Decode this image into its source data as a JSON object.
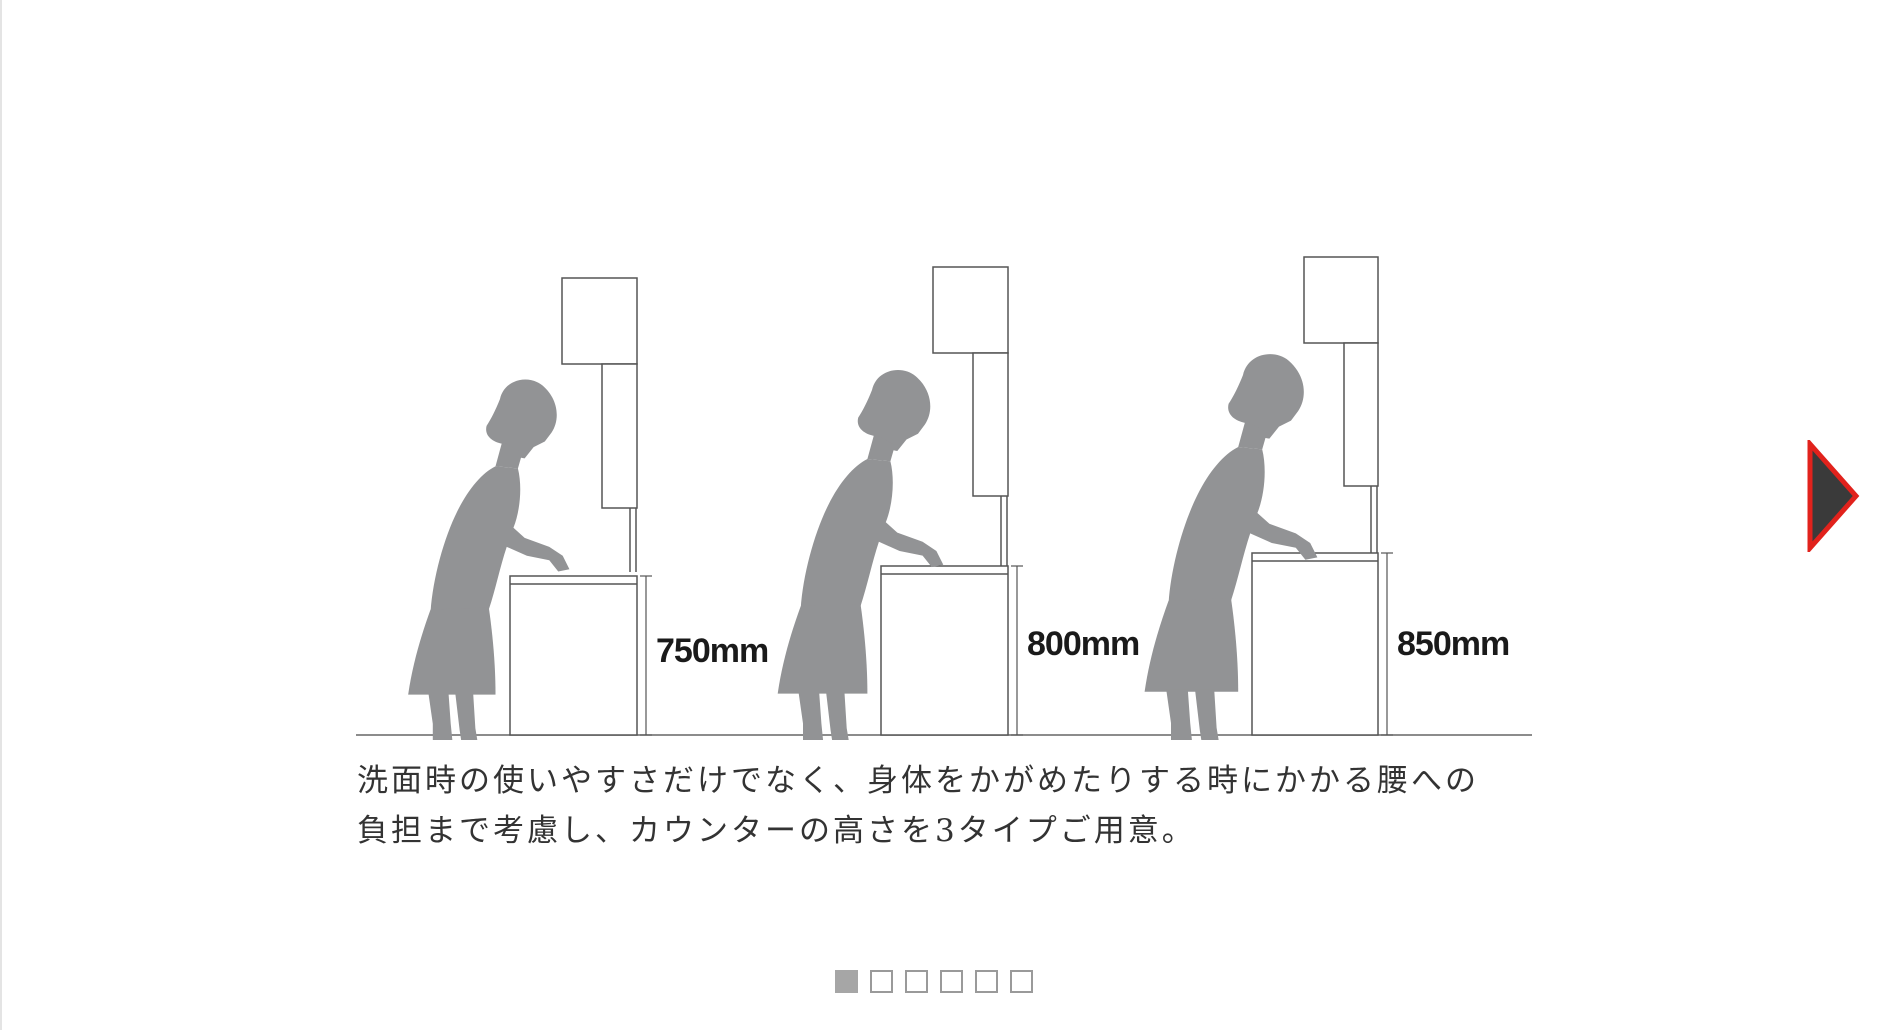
{
  "diagram": {
    "heights": [
      {
        "label": "750mm",
        "value_mm": 750
      },
      {
        "label": "800mm",
        "value_mm": 800
      },
      {
        "label": "850mm",
        "value_mm": 850
      }
    ],
    "figure_color": "#929395"
  },
  "caption": {
    "line1": "洗面時の使いやすさだけでなく、身体をかがめたりする時にかかる腰への",
    "line2": "負担まで考慮し、カウンターの高さを3タイプご用意。"
  },
  "navigation": {
    "next_icon": "next-arrow-icon",
    "accent_color": "#e1221c",
    "arrow_fill": "#3a3a3a"
  },
  "pager": {
    "count": 6,
    "active_index": 0
  }
}
